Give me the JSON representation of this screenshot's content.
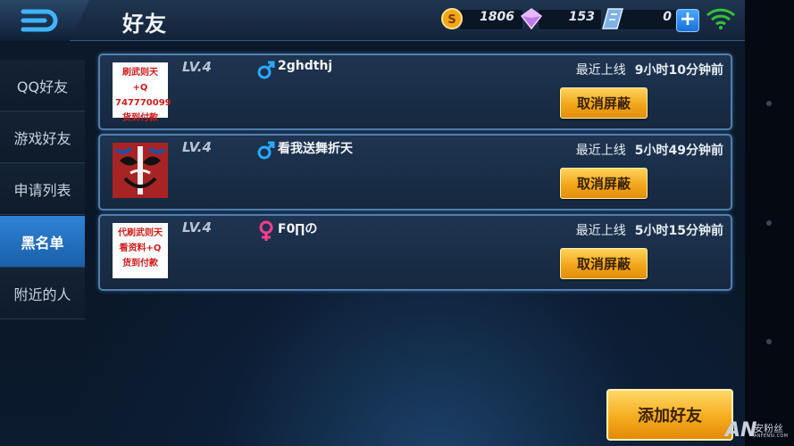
{
  "header": {
    "title": "好友",
    "coins": "1806",
    "diamonds": "153",
    "vouchers": "0",
    "plus_label": "+"
  },
  "sidebar": {
    "items": [
      {
        "label": "QQ好友"
      },
      {
        "label": "游戏好友"
      },
      {
        "label": "申请列表"
      },
      {
        "label": "黑名单"
      },
      {
        "label": "附近的人"
      }
    ]
  },
  "blacklist": [
    {
      "avatar_text": [
        "刷武则天+Q",
        "747770099",
        "货到付款"
      ],
      "level": "LV.4",
      "gender": "male",
      "name": "2ghdthj",
      "online_label": "最近上线",
      "online_time": "9小时10分钟前",
      "button": "取消屏蔽"
    },
    {
      "avatar_text": [],
      "level": "LV.4",
      "gender": "male",
      "name": "看我送舞折天",
      "online_label": "最近上线",
      "online_time": "5小时49分钟前",
      "button": "取消屏蔽"
    },
    {
      "avatar_text": [
        "代刷武则天",
        "看资料+Q",
        "货到付款"
      ],
      "level": "LV.4",
      "gender": "female",
      "name": "F0∏の",
      "online_label": "最近上线",
      "online_time": "5小时15分钟前",
      "button": "取消屏蔽"
    }
  ],
  "footer": {
    "add_friend": "添加好友"
  },
  "watermark": {
    "logo": "AN",
    "text": "安粉丝",
    "sub": "ANFENSI.COM"
  },
  "colors": {
    "male": "#2aa8ff",
    "female": "#ff3d8b",
    "accent_orange": "#f5ac1e",
    "active_tab": "#2f83d6"
  }
}
